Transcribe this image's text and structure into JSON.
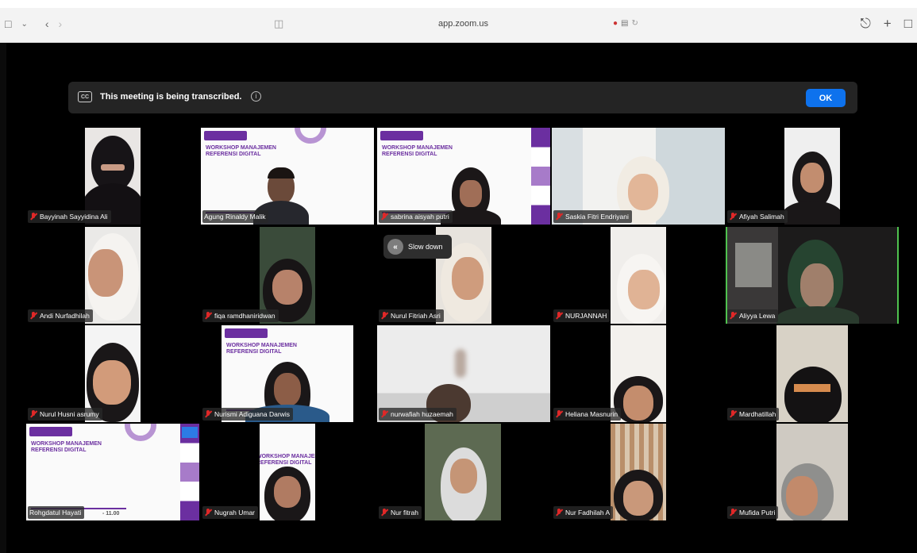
{
  "browser": {
    "url": "app.zoom.us",
    "back_icon": "chevron-left-icon",
    "forward_icon": "chevron-right-icon"
  },
  "banner": {
    "cc_label": "CC",
    "text": "This meeting is being transcribed.",
    "ok_label": "OK"
  },
  "slow_down": {
    "label": "Slow down"
  },
  "slide": {
    "title": "WORKSHOP MANAJEMEN REFERENSI DIGITAL"
  },
  "participants": [
    {
      "name": "Bayyinah Sayyidina Ali"
    },
    {
      "name": "Agung Rinaldy Malik"
    },
    {
      "name": "sabrina aisyah putri"
    },
    {
      "name": "Saskia Fitri Endriyani"
    },
    {
      "name": "Afiyah Salimah"
    },
    {
      "name": "Andi Nurfadhilah"
    },
    {
      "name": "fiqa ramdhaniridwan"
    },
    {
      "name": "Nurul Fitriah Asri"
    },
    {
      "name": "NURJANNAH"
    },
    {
      "name": "Aliyya Lewa"
    },
    {
      "name": "Nurul Husni asrumy"
    },
    {
      "name": "Nurismi Adiguana Darwis"
    },
    {
      "name": "nurwafiah huzaemah"
    },
    {
      "name": "Heliana Masnurin"
    },
    {
      "name": "Mardhatillah"
    },
    {
      "name": "Rohgdatul Hayati"
    },
    {
      "name": "Nugrah Umar"
    },
    {
      "name": "Nur fitrah"
    },
    {
      "name": "Nur Fadhilah A"
    },
    {
      "name": "Mufida Putri"
    }
  ],
  "slide_time": "- 11.00"
}
